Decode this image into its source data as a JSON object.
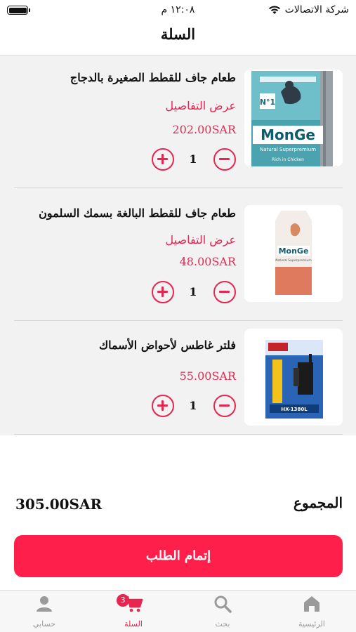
{
  "status_bar": {
    "carrier": "شركة الاتصالات",
    "time": "١٢:٠٨ م"
  },
  "header": {
    "title": "السلة"
  },
  "cart": {
    "items": [
      {
        "name": "طعام جاف للقطط الصغيرة بالدجاج",
        "details_label": "عرض التفاصيل",
        "price": "202.00SAR",
        "quantity": "1",
        "image": {
          "brand": "MonGe",
          "tagline": "Natural Superpremium",
          "badge": "N°1",
          "caption": "Rich in Chicken"
        }
      },
      {
        "name": "طعام جاف للقطط البالغة بسمك السلمون",
        "details_label": "عرض التفاصيل",
        "price": "48.00SAR",
        "quantity": "1",
        "image": {
          "brand": "MonGe",
          "tagline": "Natural Superpremium"
        }
      },
      {
        "name": "فلتر غاطس لأحواض الأسماك",
        "details_label": "",
        "price": "55.00SAR",
        "quantity": "1",
        "image": {
          "model": "HX-1380L"
        }
      }
    ]
  },
  "summary": {
    "total_label": "المجموع",
    "total_value": "305.00SAR"
  },
  "checkout": {
    "label": "إتمام الطلب"
  },
  "tab_bar": {
    "tabs": [
      {
        "label": "الرئيسية",
        "icon": "home-icon"
      },
      {
        "label": "بحث",
        "icon": "search-icon"
      },
      {
        "label": "السلة",
        "icon": "cart-icon",
        "badge": "3"
      },
      {
        "label": "حسابي",
        "icon": "person-icon"
      }
    ]
  },
  "colors": {
    "accent": "#e8254f",
    "checkout": "#ff1f4b",
    "list_background": "#f2f2f2",
    "tab_inactive": "#9a9a9a"
  }
}
